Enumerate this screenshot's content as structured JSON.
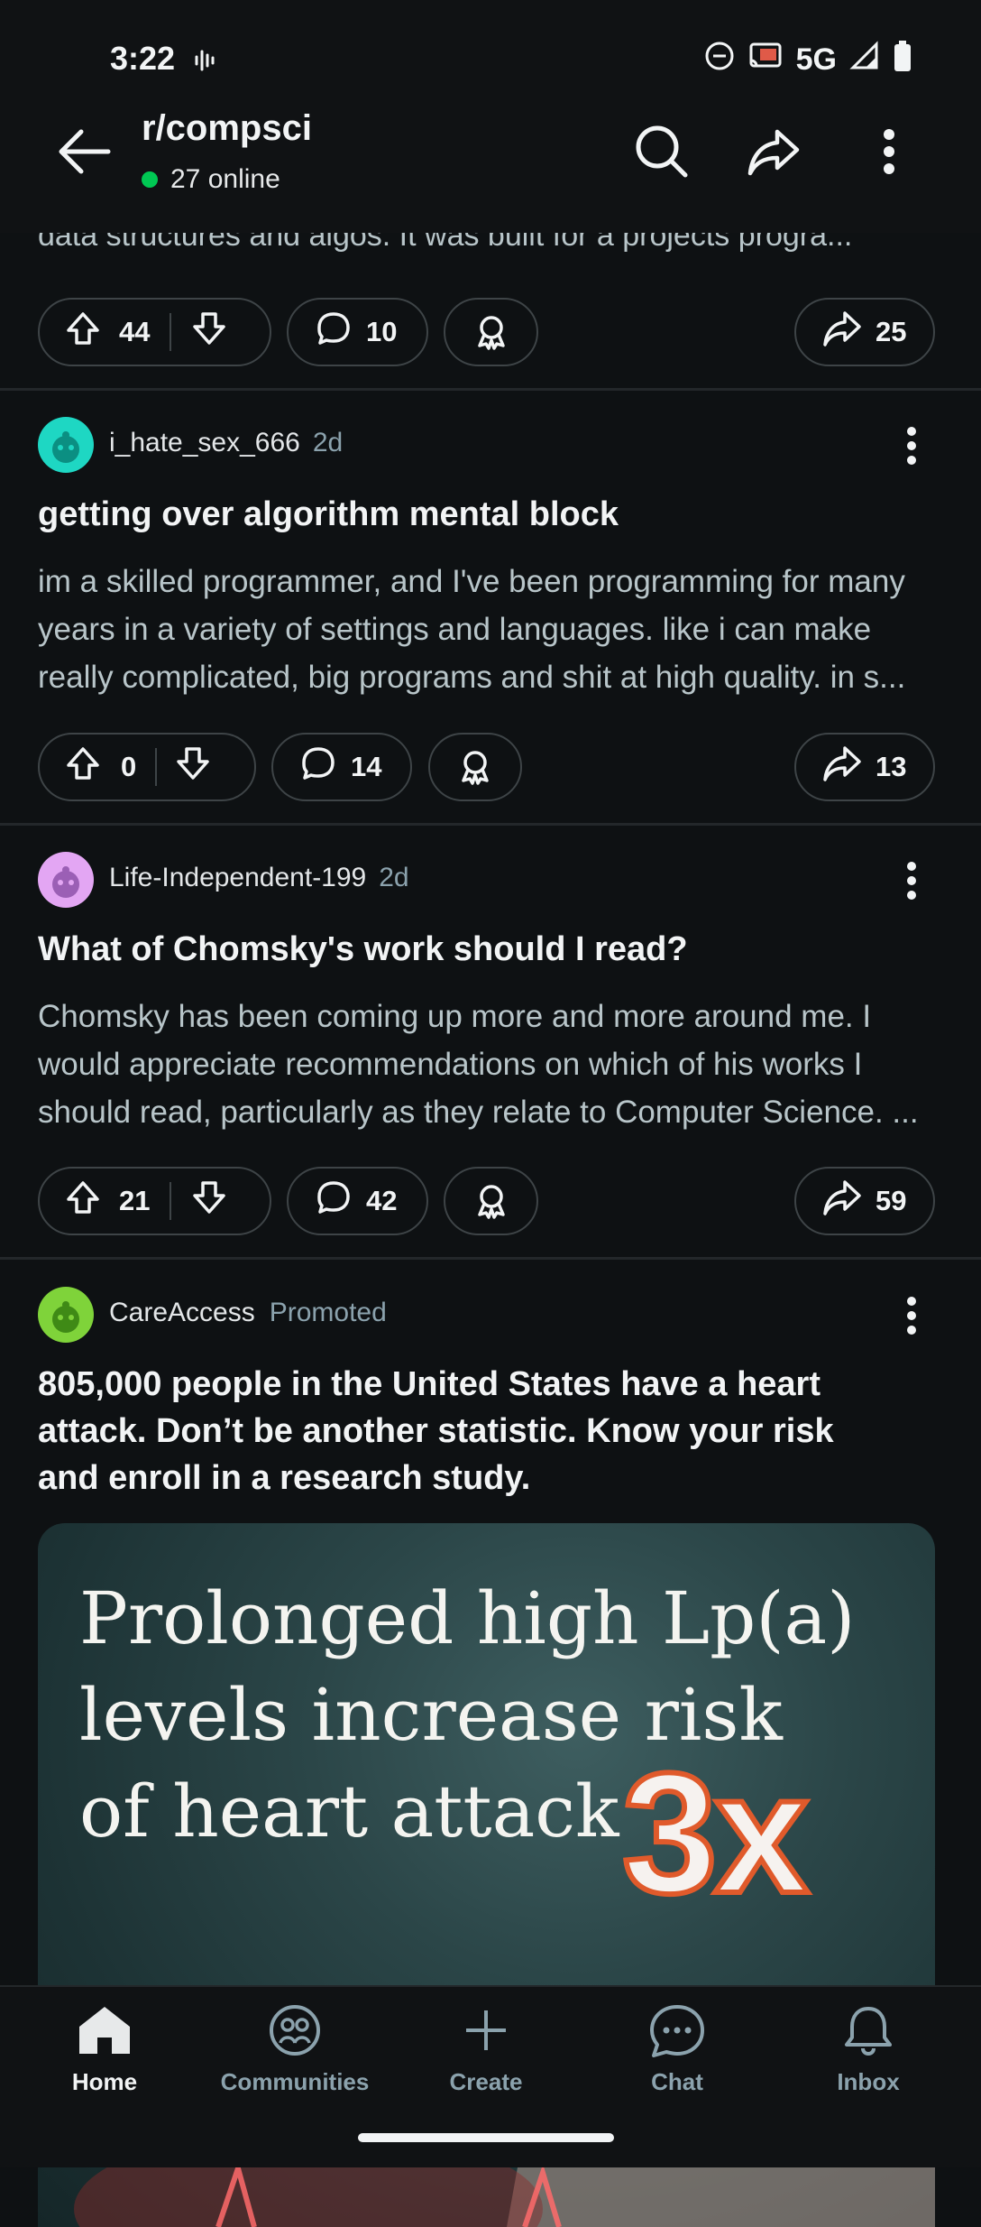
{
  "status_bar": {
    "time": "3:22",
    "network": "5G"
  },
  "header": {
    "title": "r/compsci",
    "online": "27 online"
  },
  "top_snippet": "data structures and algos. It was built for a projects progra...",
  "posts": [
    {
      "upvotes": "44",
      "comments": "10",
      "shares": "25"
    },
    {
      "author": "i_hate_sex_666",
      "age": "2d",
      "title": "getting over algorithm mental block",
      "body_lines": [
        "im a skilled programmer, and I've been programming for many",
        "years in a variety of settings and languages. like i can make",
        "really complicated, big programs and shit at high quality. in s..."
      ],
      "upvotes": "0",
      "comments": "14",
      "shares": "13",
      "avatar_color": "#1ed7c3"
    },
    {
      "author": "Life-Independent-199",
      "age": "2d",
      "title": "What of Chomsky's work should I read?",
      "body_lines": [
        "Chomsky has been coming up more and more around me. I",
        "would appreciate recommendations on which of his works I",
        "should read, particularly as they relate to Computer Science. ..."
      ],
      "upvotes": "21",
      "comments": "42",
      "shares": "59",
      "avatar_color": "#e3a6f3"
    }
  ],
  "ad": {
    "author": "CareAccess",
    "label": "Promoted",
    "title_lines": [
      "805,000 people in the United States have a heart",
      "attack. Don’t be another statistic. Know your risk",
      "and enroll in a research study."
    ],
    "image_lines": [
      "Prolonged high Lp(a)",
      "levels increase risk",
      "of heart attack"
    ],
    "image_emphasis": "3x",
    "avatar_color": "#7fd33a"
  },
  "nav": [
    {
      "label": "Home",
      "icon": "home-icon",
      "active": true
    },
    {
      "label": "Communities",
      "icon": "communities-icon"
    },
    {
      "label": "Create",
      "icon": "plus-icon"
    },
    {
      "label": "Chat",
      "icon": "chat-icon"
    },
    {
      "label": "Inbox",
      "icon": "bell-icon"
    }
  ]
}
